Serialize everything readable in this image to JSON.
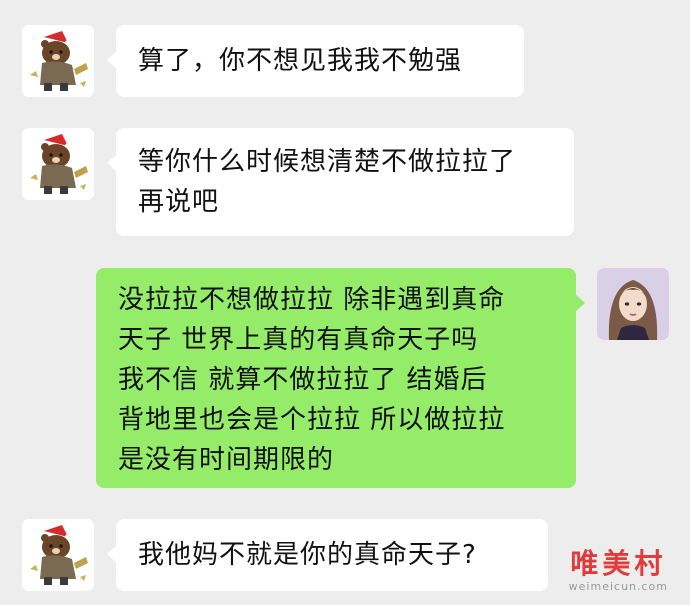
{
  "messages": [
    {
      "side": "left",
      "avatar": "bear-avatar-icon",
      "lines": [
        "算了，你不想见我我不勉强"
      ]
    },
    {
      "side": "left",
      "avatar": "bear-avatar-icon",
      "lines": [
        "等你什么时候想清楚不做拉拉了",
        "再说吧"
      ]
    },
    {
      "side": "right",
      "avatar": "girl-avatar-icon",
      "lines": [
        "没拉拉不想做拉拉 除非遇到真命",
        "天子 世界上真的有真命天子吗",
        "我不信 就算不做拉拉了 结婚后",
        "背地里也会是个拉拉 所以做拉拉",
        "是没有时间期限的"
      ]
    },
    {
      "side": "left",
      "avatar": "bear-avatar-icon",
      "lines": [
        "我他妈不就是你的真命天子?"
      ]
    }
  ],
  "watermark": {
    "text": "唯美村",
    "url": "weimeicun.com"
  },
  "colors": {
    "background": "#ededed",
    "sent_bubble": "#95ec69",
    "received_bubble": "#ffffff",
    "watermark": "#e23b3b"
  }
}
